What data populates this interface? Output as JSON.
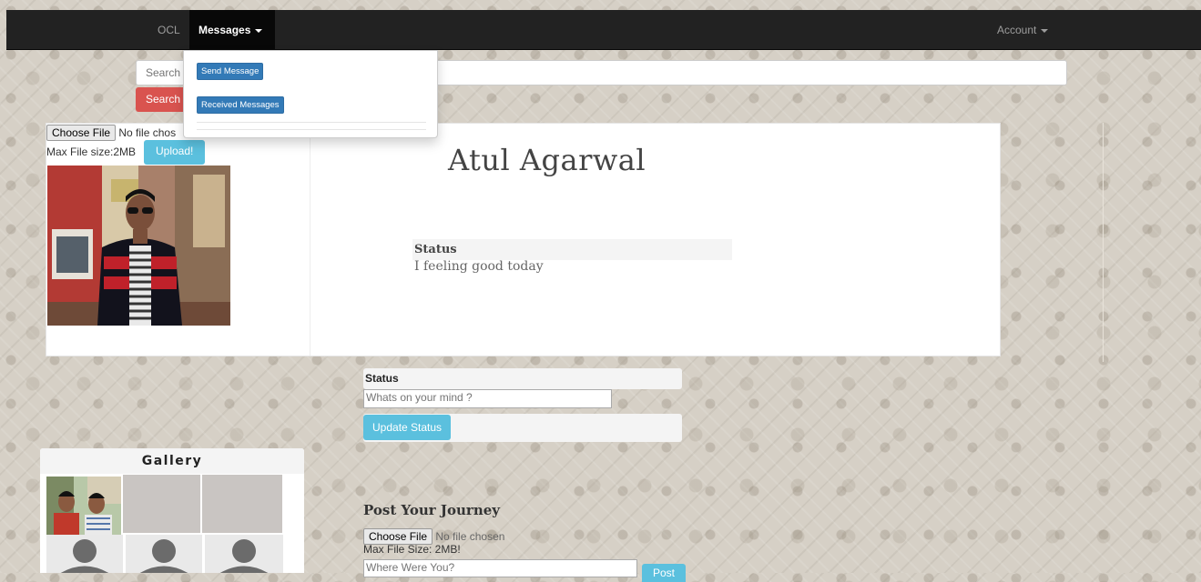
{
  "navbar": {
    "brand": "OCL",
    "messages_label": "Messages",
    "account_label": "Account"
  },
  "messages_menu": {
    "items": [
      {
        "label": "Send Message"
      },
      {
        "label": "Received Messages"
      }
    ]
  },
  "search": {
    "placeholder": "Search",
    "button_label": "Search"
  },
  "profile": {
    "name": "Atul Agarwal",
    "choose_file_label": "Choose File",
    "no_file_label": "No file chos",
    "max_file_label": "Max File size:2MB",
    "upload_label": "Upload!",
    "status_heading": "Status",
    "status_text": "I feeling good today"
  },
  "status_update": {
    "heading": "Status",
    "placeholder": "Whats on your mind ?",
    "button_label": "Update Status"
  },
  "gallery": {
    "title": "Gallery"
  },
  "journey": {
    "title": "Post Your Journey",
    "choose_file_label": "Choose File",
    "no_file_label": "No file chosen",
    "max_size_label": "Max File Size: 2MB!",
    "placeholder": "Where Were You?",
    "post_label": "Post"
  }
}
